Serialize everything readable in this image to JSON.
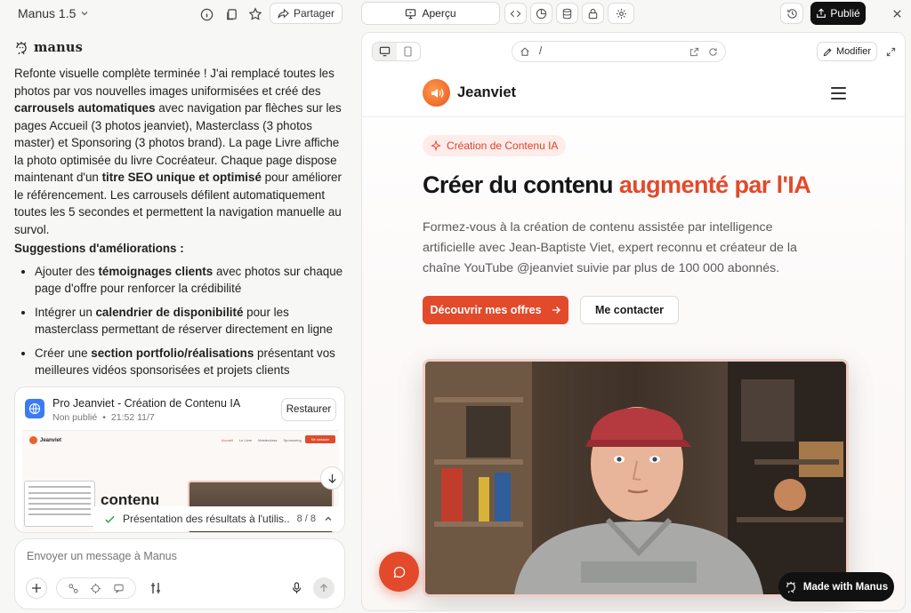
{
  "app": {
    "title": "Manus 1.5",
    "share_label": "Partager",
    "preview_label": "Aperçu",
    "published_label": "Publié"
  },
  "chat": {
    "sender": "manus",
    "intro": {
      "t1": "Refonte visuelle complète terminée ! J'ai remplacé toutes les photos par vos nouvelles images uniformisées et créé des ",
      "b1": "carrousels automatiques",
      "t2": " avec navigation par flèches sur les pages Accueil (3 photos jeanviet), Masterclass (3 photos master) et Sponsoring (3 photos brand). La page Livre affiche la photo optimisée du livre Cocréateur. Chaque page dispose maintenant d'un ",
      "b2": "titre SEO unique et optimisé",
      "t3": " pour améliorer le référencement. Les carrousels défilent automatiquement toutes les 5 secondes et permettent la navigation manuelle au survol."
    },
    "suggestions_title": "Suggestions d'améliorations :",
    "suggestions": [
      {
        "a": "Ajouter des ",
        "b": "témoignages clients",
        "c": " avec photos sur chaque page d'offre pour renforcer la crédibilité"
      },
      {
        "a": "Intégrer un ",
        "b": "calendrier de disponibilité",
        "c": " pour les masterclass permettant de réserver directement en ligne"
      },
      {
        "a": "Créer une ",
        "b": "section portfolio/réalisations",
        "c": " présentant vos meilleures vidéos sponsorisées et projets clients"
      }
    ],
    "card": {
      "title": "Pro Jeanviet - Création de Contenu IA",
      "status": "Non publié",
      "time": "21:52 11/7",
      "restore_label": "Restaurer",
      "thumb_brand": "Jeanviet",
      "thumb_heading": "contenu",
      "thumb_nav": [
        "Accueil",
        "Le Livre",
        "Masterclass",
        "Sponsoring"
      ],
      "thumb_cta": "Me contacter",
      "task_label": "Présentation des résultats à l'utilis...",
      "task_count": "8 / 8"
    },
    "composer_placeholder": "Envoyer un message à Manus"
  },
  "preview": {
    "url_path": "/",
    "edit_label": "Modifier",
    "site": {
      "brand": "Jeanviet",
      "badge": "Création de Contenu IA",
      "headline_plain": "Créer du contenu ",
      "headline_accent": "augmenté par l'IA",
      "description": "Formez-vous à la création de contenu assistée par intelligence artificielle avec Jean-Baptiste Viet, expert reconnu et créateur de la chaîne YouTube @jeanviet suivie par plus de 100 000 abonnés.",
      "primary_cta": "Découvrir mes offres",
      "secondary_cta": "Me contacter",
      "made_with": "Made with Manus"
    }
  },
  "colors": {
    "accent": "#e24a2b",
    "badge_bg": "#fdecea",
    "dark": "#111111"
  },
  "icons": [
    "info-icon",
    "copy-icon",
    "star-icon",
    "share-icon",
    "monitor-icon",
    "code-icon",
    "chart-icon",
    "database-icon",
    "lock-icon",
    "gear-icon",
    "history-icon",
    "upload-icon",
    "close-icon",
    "desktop-icon",
    "mobile-icon",
    "home-icon",
    "external-link-icon",
    "refresh-icon",
    "edit-icon",
    "expand-icon",
    "hamburger-icon",
    "sparkle-icon",
    "arrow-right-icon",
    "chat-icon",
    "globe-icon",
    "check-icon",
    "chevron-up-icon",
    "arrow-down-icon",
    "plus-icon",
    "mic-icon",
    "send-icon"
  ]
}
